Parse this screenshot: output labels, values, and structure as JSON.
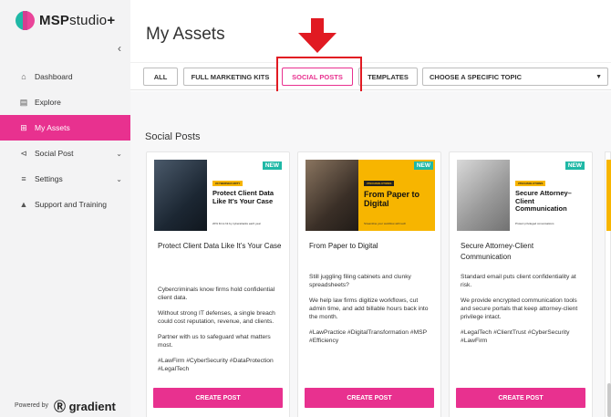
{
  "brand": {
    "name_bold": "MSP",
    "name_light": "studio",
    "name_suffix": "+"
  },
  "sidebar": {
    "collapse_icon": "chevron-left-icon",
    "items": [
      {
        "label": "Dashboard",
        "icon": "home-icon",
        "active": false
      },
      {
        "label": "Explore",
        "icon": "explore-icon",
        "active": false
      },
      {
        "label": "My Assets",
        "icon": "grid-icon",
        "active": true
      },
      {
        "label": "Social Post",
        "icon": "share-icon",
        "active": false,
        "expandable": true
      },
      {
        "label": "Settings",
        "icon": "sliders-icon",
        "active": false,
        "expandable": true
      },
      {
        "label": "Support and Training",
        "icon": "graduation-cap-icon",
        "active": false
      }
    ],
    "powered_by": "Powered by",
    "powered_brand": "gradient"
  },
  "main": {
    "title": "My Assets",
    "filters": {
      "all": "ALL",
      "kits": "FULL MARKETING KITS",
      "social": "SOCIAL POSTS",
      "templates": "TEMPLATES",
      "topic_select": "CHOOSE A SPECIFIC TOPIC"
    },
    "section_title": "Social Posts",
    "cards": [
      {
        "badge": "NEW",
        "thumb_tag": "#CYBERSECURITY",
        "thumb_head": "Protect Client Data Like It’s Your Case",
        "thumb_sub": "20% firms hit by cyberattacks each year",
        "title": "Protect Client Data Like It’s Your Case",
        "p1": "Cybercriminals know firms hold confidential client data.",
        "p2": "Without strong IT defenses, a single breach could cost reputation, revenue, and clients.",
        "p3": "Partner with us to safeguard what matters most.",
        "p4": "#LawFirm #CyberSecurity #DataProtection #LegalTech",
        "button": "CREATE POST"
      },
      {
        "badge": "NEW",
        "thumb_tag": "#TECHSOLUTIONS",
        "thumb_head": "From Paper to Digital",
        "thumb_sub": "Streamline your workflow with tech",
        "title": "From Paper to Digital",
        "p1": "Still juggling filing cabinets and clunky spreadsheets?",
        "p2": "We help law firms digitize workflows, cut admin time, and add billable hours back into the month.",
        "p3": "#LawPractice #DigitalTransformation #MSP #Efficiency",
        "p4": "",
        "button": "CREATE POST"
      },
      {
        "badge": "NEW",
        "thumb_tag": "#TECHSOLUTIONS",
        "thumb_head": "Secure Attorney–Client Communication",
        "thumb_sub": "Protect privileged conversations",
        "title": "Secure Attorney-Client Communication",
        "p1": "Standard email puts client confidentiality at risk.",
        "p2": "We provide encrypted communication tools and secure portals that keep attorney-client privilege intact.",
        "p3": "#LegalTech #ClientTrust #CyberSecurity #LawFirm",
        "p4": "",
        "button": "CREATE POST"
      }
    ]
  },
  "colors": {
    "accent": "#e8318f",
    "teal": "#1fb8a6",
    "yellow": "#f7b500",
    "annotation_red": "#e11a22"
  }
}
